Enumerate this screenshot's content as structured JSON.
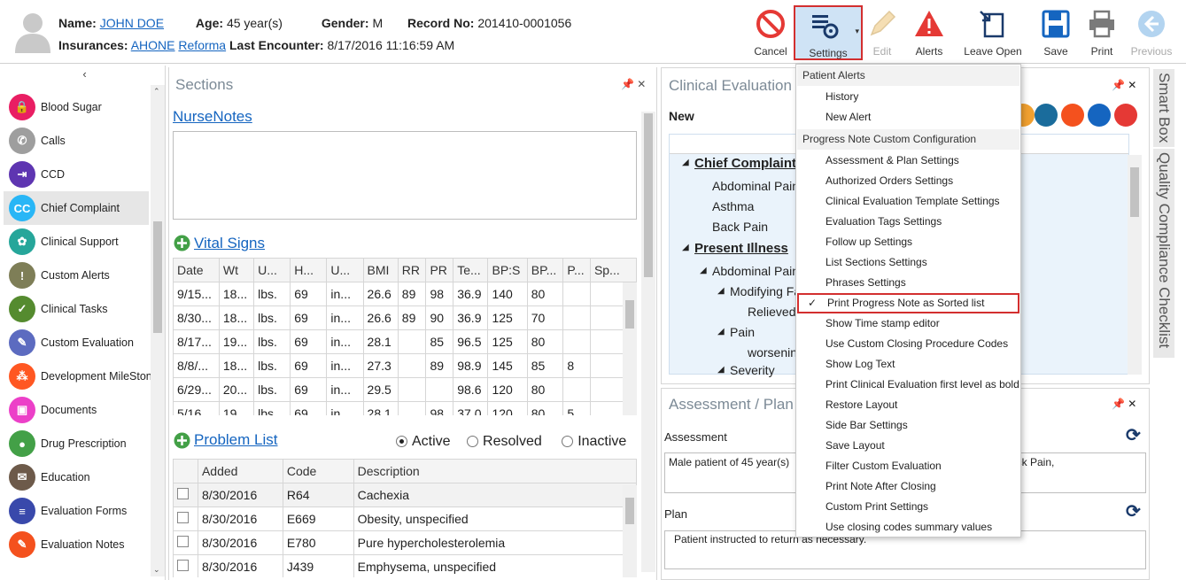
{
  "header": {
    "name_label": "Name:",
    "name": "JOHN DOE",
    "age_label": "Age:",
    "age": "45 year(s)",
    "gender_label": "Gender:",
    "gender": "M",
    "record_label": "Record No:",
    "record": "201410-0001056",
    "insurances_label": "Insurances:",
    "insurance1": "AHONE",
    "insurance2": "Reforma",
    "encounter_label": "Last Encounter:",
    "encounter": "8/17/2016 11:16:59 AM"
  },
  "toolbar": {
    "cancel": "Cancel",
    "settings": "Settings",
    "edit": "Edit",
    "alerts": "Alerts",
    "leave_open": "Leave Open",
    "save": "Save",
    "print": "Print",
    "previous": "Previous"
  },
  "sidebar": {
    "collapse": "‹",
    "items": [
      {
        "label": "Blood Sugar",
        "color": "#e91e63",
        "glyph": "🔒"
      },
      {
        "label": "Calls",
        "color": "#9e9e9e",
        "glyph": "✆"
      },
      {
        "label": "CCD",
        "color": "#5e35b1",
        "glyph": "⇥"
      },
      {
        "label": "Chief Complaint",
        "color": "#29b6f6",
        "glyph": "CC"
      },
      {
        "label": "Clinical Support",
        "color": "#26a69a",
        "glyph": "✿"
      },
      {
        "label": "Custom Alerts",
        "color": "#7e7e57",
        "glyph": "!"
      },
      {
        "label": "Clinical Tasks",
        "color": "#558b2f",
        "glyph": "✓"
      },
      {
        "label": "Custom Evaluation",
        "color": "#5c6bc0",
        "glyph": "✎"
      },
      {
        "label": "Development MileSton",
        "color": "#ff5722",
        "glyph": "⁂"
      },
      {
        "label": "Documents",
        "color": "#ec40c8",
        "glyph": "▣"
      },
      {
        "label": "Drug Prescription",
        "color": "#43a047",
        "glyph": "●"
      },
      {
        "label": "Education",
        "color": "#6d5a4a",
        "glyph": "✉"
      },
      {
        "label": "Evaluation Forms",
        "color": "#3949ab",
        "glyph": "≡"
      },
      {
        "label": "Evaluation Notes",
        "color": "#f4511e",
        "glyph": "✎"
      }
    ]
  },
  "sections": {
    "title": "Sections",
    "pin": "📌 ✕",
    "nurse_notes": "NurseNotes",
    "vital_signs": "Vital Signs",
    "vitals_headers": [
      "Date",
      "Wt",
      "U...",
      "H...",
      "U...",
      "BMI",
      "RR",
      "PR",
      "Te...",
      "BP:S",
      "BP...",
      "P...",
      "Sp..."
    ],
    "vitals_rows": [
      [
        "9/15...",
        "18...",
        "lbs.",
        "69",
        "in...",
        "26.6",
        "89",
        "98",
        "36.9",
        "140",
        "80",
        "",
        ""
      ],
      [
        "8/30...",
        "18...",
        "lbs.",
        "69",
        "in...",
        "26.6",
        "89",
        "90",
        "36.9",
        "125",
        "70",
        "",
        ""
      ],
      [
        "8/17...",
        "19...",
        "lbs.",
        "69",
        "in...",
        "28.1",
        "",
        "85",
        "96.5",
        "125",
        "80",
        "",
        ""
      ],
      [
        "8/8/...",
        "18...",
        "lbs.",
        "69",
        "in...",
        "27.3",
        "",
        "89",
        "98.9",
        "145",
        "85",
        "8",
        ""
      ],
      [
        "6/29...",
        "20...",
        "lbs.",
        "69",
        "in...",
        "29.5",
        "",
        "",
        "98.6",
        "120",
        "80",
        "",
        ""
      ],
      [
        "5/16",
        "19",
        "lbs",
        "69",
        "in",
        "28.1",
        "",
        "98",
        "37.0",
        "120",
        "80",
        "5",
        ""
      ]
    ],
    "problem_list": "Problem List",
    "filter_active": "Active",
    "filter_resolved": "Resolved",
    "filter_inactive": "Inactive",
    "problem_headers": [
      "Added",
      "Code",
      "Description"
    ],
    "problems": [
      [
        "8/30/2016",
        "R64",
        "Cachexia"
      ],
      [
        "8/30/2016",
        "E669",
        "Obesity, unspecified"
      ],
      [
        "8/30/2016",
        "E780",
        "Pure hypercholesterolemia"
      ],
      [
        "8/30/2016",
        "J439",
        "Emphysema, unspecified"
      ]
    ]
  },
  "clinical": {
    "title": "Clinical Evaluation",
    "new": "New",
    "tree": [
      "Chief Complaint",
      "Abdominal Pain",
      "Asthma",
      "Back Pain",
      "Present Illness",
      "Abdominal Pain",
      "Modifying Fac",
      "Relieved",
      "Pain",
      "worsening",
      "Severity"
    ]
  },
  "assessment": {
    "title": "Assessment / Plan",
    "assessment_label": "Assessment",
    "assessment_text": "Male patient of 45 year(s)",
    "assessment_text_tail": "ack Pain,",
    "plan_label": "Plan",
    "plan_text": "Patient instructed to return as necessary."
  },
  "right_tabs": {
    "smart_box": "Smart Box",
    "quality": "Quality Compliance Checklist"
  },
  "menu": {
    "patient_alerts": "Patient Alerts",
    "alerts_items": [
      "History",
      "New Alert"
    ],
    "progress_header": "Progress Note Custom Configuration",
    "items": [
      "Assessment & Plan Settings",
      "Authorized Orders Settings",
      "Clinical Evaluation Template Settings",
      "Evaluation Tags Settings",
      "Follow up Settings",
      "List Sections Settings",
      "Phrases Settings",
      "Print Progress Note as Sorted list",
      "Show Time stamp editor",
      "Use Custom Closing Procedure Codes",
      "Show Log Text",
      "Print Clinical Evaluation first level as bold",
      "Restore Layout",
      "Side Bar Settings",
      "Save Layout",
      "Filter Custom Evaluation",
      "Print Note After Closing",
      "Custom Print Settings",
      "Use closing codes summary values"
    ],
    "check": "✓"
  }
}
